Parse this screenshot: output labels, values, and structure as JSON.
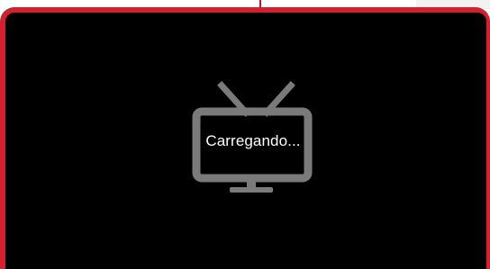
{
  "player": {
    "status_text": "Carregando...",
    "icon": "tv-icon",
    "colors": {
      "frame": "#d31f2e",
      "screen": "#000000",
      "icon": "#7a7a7a",
      "text": "#ffffff"
    }
  }
}
